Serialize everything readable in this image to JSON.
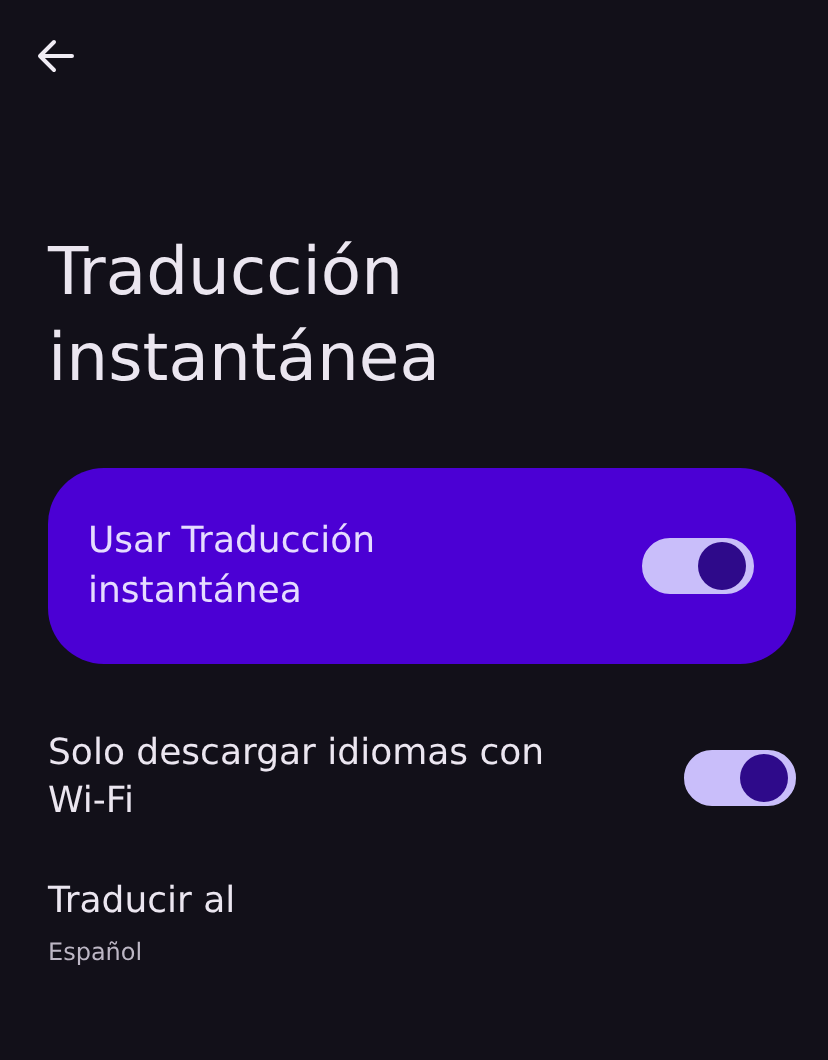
{
  "title": "Traducción instantánea",
  "main_switch": {
    "label": "Usar Traducción instantánea",
    "checked": true
  },
  "preferences": [
    {
      "kind": "switch",
      "label": "Solo descargar idiomas con Wi-Fi",
      "checked": true
    },
    {
      "kind": "value",
      "label": "Traducir al",
      "summary": "Español"
    }
  ]
}
